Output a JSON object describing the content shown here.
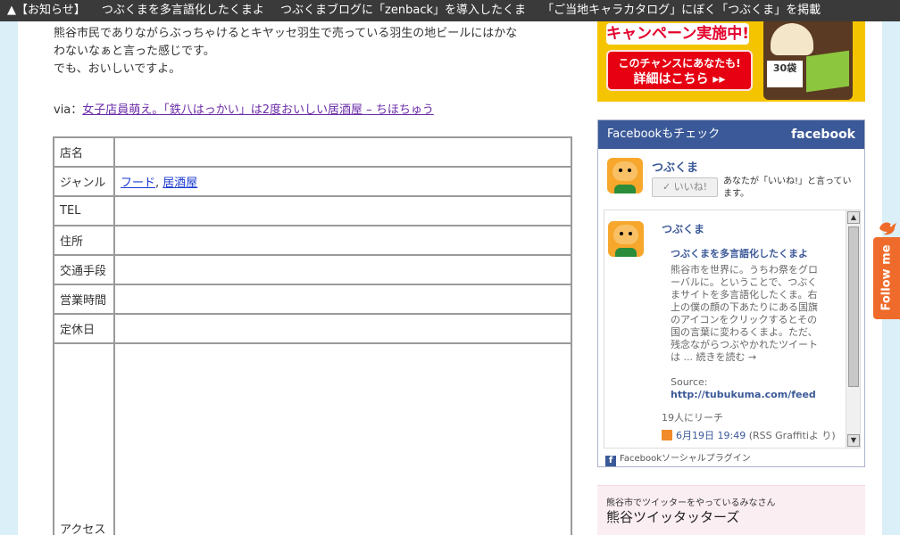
{
  "topbar": {
    "items": [
      "▲【お知らせ】",
      "つぶくまを多言語化したくまよ",
      "つぶくまブログに「zenback」を導入したくま",
      "「ご当地キャラカタログ」にぼく「つぶくま」を掲載"
    ]
  },
  "article": {
    "line1": "熊谷市民でありながらぶっちゃけるとキヤッセ羽生で売っている羽生の地ビールにはかな",
    "line2": "わないなぁと言った感じです。",
    "line3": "でも、おいしいですよ。",
    "via_prefix": "via：",
    "via_link": "女子店員萌え。「鉄八はっかい」は2度おいしい居酒屋 – ちほちゅう"
  },
  "table": {
    "rows": [
      {
        "key": "店名",
        "value": ""
      },
      {
        "key": "ジャンル",
        "links": [
          "フード",
          "居酒屋"
        ],
        "sep": ", "
      },
      {
        "key": "TEL",
        "value": ""
      },
      {
        "key": "住所",
        "value": ""
      },
      {
        "key": "交通手段",
        "value": ""
      },
      {
        "key": "営業時間",
        "value": ""
      },
      {
        "key": "定休日",
        "value": ""
      },
      {
        "key": "アクセス",
        "value": ""
      }
    ]
  },
  "ad": {
    "campaign": "キャンペーン実施中!",
    "chance_line1": "このチャンスにあなたも!",
    "chance_line2": "詳細はこちら ▸▸",
    "pack_label": "30袋"
  },
  "facebook": {
    "header": "Facebookもチェック",
    "logo": "facebook",
    "page_name": "つぶくま",
    "like_button": "✓ いいね!",
    "like_text": "あなたが「いいね!」と言っています。",
    "post": {
      "author": "つぶくま",
      "title": "つぶくまを多言語化したくまよ",
      "body": "熊谷市を世界に。うちわ祭をグローバルに。ということで、つぶくまサイトを多言語化したくま。右上の僕の顔の下あたりにある国旗のアイコンをクリックするとその国の言葉に変わるくまよ。ただ、残念ながらつぶやかれたツイートは ... 続きを読む →",
      "source_label": "Source:",
      "source_url": "http://tubukuma.com/feed",
      "reach": "19人にリーチ",
      "date": "6月19日 19:49",
      "via": "(RSS Graffitiよ り)"
    },
    "footer": "Facebookソーシャルプラグイン"
  },
  "twitter": {
    "small": "熊谷市でツイッターをやっているみなさん",
    "big": "熊谷ツイッタッターズ"
  },
  "follow": {
    "label": "Follow me"
  },
  "colors": {
    "topbar": "#3a3a3a",
    "facebook_blue": "#3b5998",
    "follow_orange": "#ef6b2c",
    "band": "#dbeff8"
  }
}
